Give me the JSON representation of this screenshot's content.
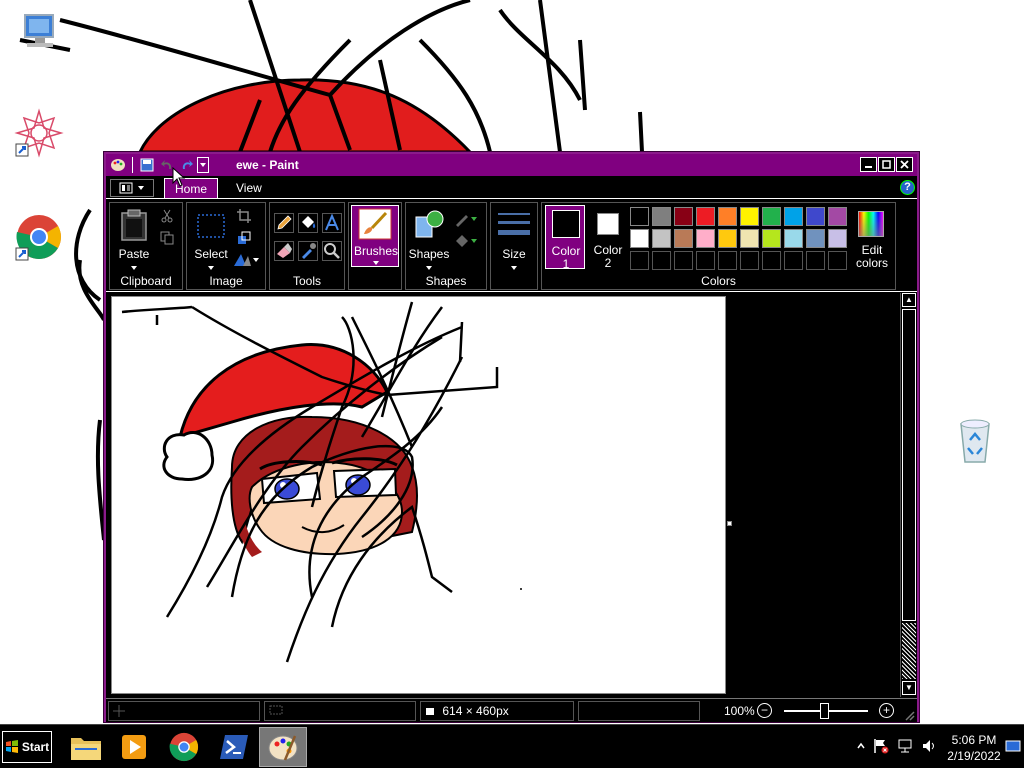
{
  "window": {
    "title": "ewe - Paint"
  },
  "tabs": {
    "home": "Home",
    "view": "View"
  },
  "ribbon": {
    "clipboard": {
      "label": "Clipboard",
      "paste": "Paste"
    },
    "image": {
      "label": "Image",
      "select": "Select"
    },
    "tools": {
      "label": "Tools"
    },
    "brushes": {
      "label": "Brushes"
    },
    "shapes": {
      "label": "Shapes",
      "shapes_btn": "Shapes"
    },
    "size": {
      "label": "Size"
    },
    "colors": {
      "label": "Colors",
      "color1_line1": "Color",
      "color1_line2": "1",
      "color2_line1": "Color",
      "color2_line2": "2",
      "edit_line1": "Edit",
      "edit_line2": "colors",
      "color1_value": "#000000",
      "color2_value": "#ffffff",
      "palette_row1": [
        "#000000",
        "#7f7f7f",
        "#880015",
        "#ed1c24",
        "#ff7f27",
        "#fff200",
        "#22b14c",
        "#00a2e8",
        "#3f48cc",
        "#a349a4"
      ],
      "palette_row2": [
        "#ffffff",
        "#c3c3c3",
        "#b97a57",
        "#ffaec9",
        "#ffc90e",
        "#efe4b0",
        "#b5e61d",
        "#99d9ea",
        "#7092be",
        "#c8bfe7"
      ]
    }
  },
  "status": {
    "image_size": "614 × 460px",
    "zoom": "100%"
  },
  "taskbar": {
    "start": "Start",
    "time": "5:06 PM",
    "date": "2/19/2022"
  },
  "colors": {
    "title_bar": "#800080",
    "accent": "#800080",
    "background": "#000000"
  }
}
